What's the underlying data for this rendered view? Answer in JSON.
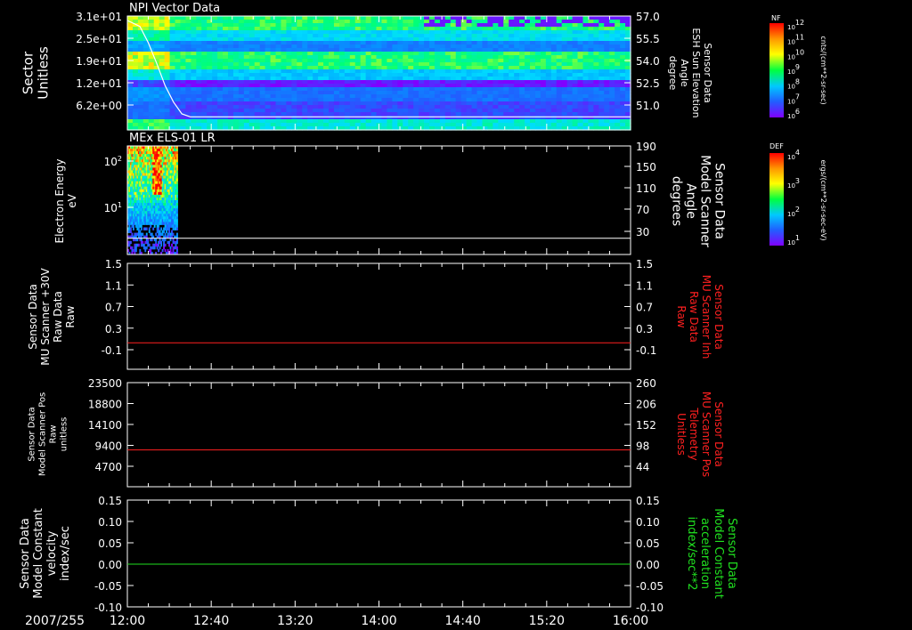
{
  "chart_data": {
    "type": "stacked-time-series",
    "date_label": "2007/255",
    "x_ticks": [
      "12:00",
      "12:40",
      "13:20",
      "14:00",
      "14:40",
      "15:20",
      "16:00"
    ],
    "panels": [
      {
        "id": "npi",
        "type": "heatmap",
        "title": "NPI Vector Data",
        "ylabel_left": [
          "Sector",
          "Unitless"
        ],
        "ylabel_right": [
          "Sensor Data",
          "ESH Sun Elevation",
          "Angle",
          "degree"
        ],
        "yticks_left": [
          "3.1e+01",
          "2.5e+01",
          "1.9e+01",
          "1.2e+01",
          "6.2e+00"
        ],
        "yticks_right": [
          "57.0",
          "55.5",
          "54.0",
          "52.5",
          "51.0"
        ],
        "overlay_line": {
          "name": "ESH Sun Elevation",
          "color": "#ffffff",
          "x_minutes": [
            0,
            6,
            10,
            14,
            18,
            22,
            26,
            30,
            240
          ],
          "values": [
            56.7,
            56.3,
            55.2,
            53.8,
            52.3,
            51.2,
            50.4,
            50.2,
            50.2
          ]
        },
        "colorbar": {
          "label": "NF",
          "ticks": [
            "10^12",
            "10^11",
            "10^10",
            "10^9",
            "10^8",
            "10^7",
            "10^6"
          ],
          "units": "cnts/(cm**2-sr-sec)"
        }
      },
      {
        "id": "els",
        "type": "heatmap",
        "title": "MEx ELS-01 LR",
        "ylabel_left": [
          "Electron Energy",
          "eV"
        ],
        "ylabel_right": [
          "Sensor Data",
          "Model Scanner",
          "Angle",
          "degrees"
        ],
        "yticks_left": [
          "10^2",
          "10^1"
        ],
        "yticks_right": [
          "190",
          "150",
          "110",
          "70",
          "30"
        ],
        "data_extent_minutes": [
          0,
          24
        ],
        "overlay_line": {
          "name": "Model Scanner Angle",
          "color": "#ffffff",
          "value": 17
        },
        "colorbar": {
          "label": "DEF",
          "ticks": [
            "10^4",
            "10^3",
            "10^2",
            "10^1"
          ],
          "units": "ergs/(cm**2-sr-sec-eV)"
        }
      },
      {
        "id": "raw30v",
        "type": "line",
        "ylabel_left": [
          "Sensor Data",
          "MU Scanner +30V",
          "Raw Data",
          "Raw"
        ],
        "ylabel_right": [
          "Sensor Data",
          "MU Scanner Inh",
          "Raw Data",
          "Raw"
        ],
        "ylabel_right_color": "#ff2020",
        "yticks_left": [
          "1.5",
          "1.1",
          "0.7",
          "0.3",
          "-0.1"
        ],
        "yticks_right": [
          "1.5",
          "1.1",
          "0.7",
          "0.3",
          "-0.1"
        ],
        "ylim": [
          -0.5,
          1.5
        ],
        "series": [
          {
            "color": "#ff2020",
            "value": 0.0
          }
        ]
      },
      {
        "id": "scanpos",
        "type": "line",
        "ylabel_left": [
          "Sensor Data",
          "Model Scanner Pos",
          "Raw",
          "unitless"
        ],
        "ylabel_right": [
          "Sensor Data",
          "MU Scanner Pos",
          "Telemetry",
          "Unitless"
        ],
        "ylabel_right_color": "#ff2020",
        "yticks_left": [
          "23500",
          "18800",
          "14100",
          "9400",
          "4700"
        ],
        "yticks_right": [
          "260",
          "206",
          "152",
          "98",
          "44"
        ],
        "ylim": [
          0,
          23500
        ],
        "series": [
          {
            "color": "#ff2020",
            "value": 8300
          }
        ]
      },
      {
        "id": "constant",
        "type": "line",
        "ylabel_left": [
          "Sensor Data",
          "Model Constant",
          "velocity",
          "index/sec"
        ],
        "ylabel_right": [
          "Sensor Data",
          "Model Constant",
          "acceleration",
          "index/sec**2"
        ],
        "ylabel_right_color": "#20e020",
        "yticks_left": [
          "0.15",
          "0.10",
          "0.05",
          "0.00",
          "-0.05",
          "-0.10"
        ],
        "yticks_right": [
          "0.15",
          "0.10",
          "0.05",
          "0.00",
          "-0.05",
          "-0.10"
        ],
        "ylim": [
          -0.1,
          0.15
        ],
        "series": [
          {
            "color": "#20e020",
            "value": 0.0
          }
        ]
      }
    ]
  }
}
